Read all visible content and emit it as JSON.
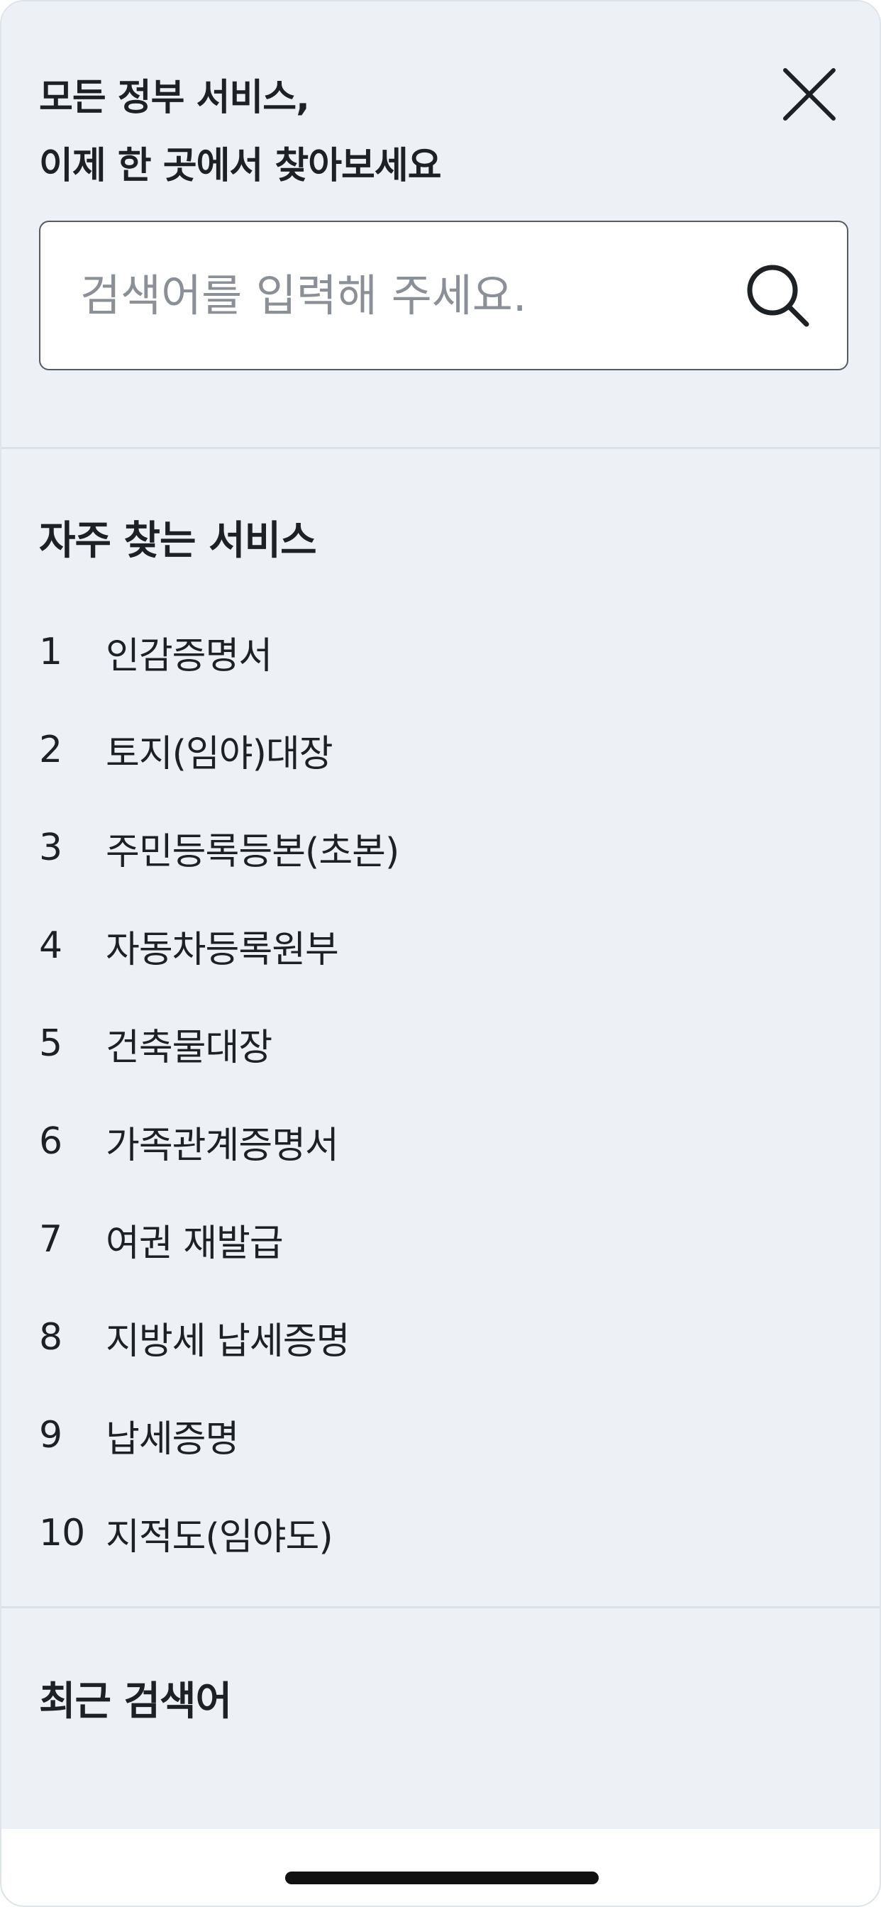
{
  "header": {
    "headline_line1": "모든 정부 서비스,",
    "headline_line2": "이제 한 곳에서 찾아보세요",
    "close_icon": "close-icon"
  },
  "search": {
    "placeholder": "검색어를 입력해 주세요.",
    "value": "",
    "icon": "search-icon"
  },
  "popular": {
    "title": "자주 찾는 서비스",
    "items": [
      {
        "rank": "1",
        "label": "인감증명서"
      },
      {
        "rank": "2",
        "label": "토지(임야)대장"
      },
      {
        "rank": "3",
        "label": "주민등록등본(초본)"
      },
      {
        "rank": "4",
        "label": "자동차등록원부"
      },
      {
        "rank": "5",
        "label": "건축물대장"
      },
      {
        "rank": "6",
        "label": "가족관계증명서"
      },
      {
        "rank": "7",
        "label": "여권 재발급"
      },
      {
        "rank": "8",
        "label": "지방세 납세증명"
      },
      {
        "rank": "9",
        "label": "납세증명"
      },
      {
        "rank": "10",
        "label": "지적도(임야도)"
      }
    ]
  },
  "recent": {
    "title": "최근 검색어"
  },
  "colors": {
    "panel_background": "#edf1f6",
    "text_primary": "#1e2124",
    "placeholder": "#8b9096",
    "input_border": "#565b62",
    "divider": "#dbe1e8"
  }
}
